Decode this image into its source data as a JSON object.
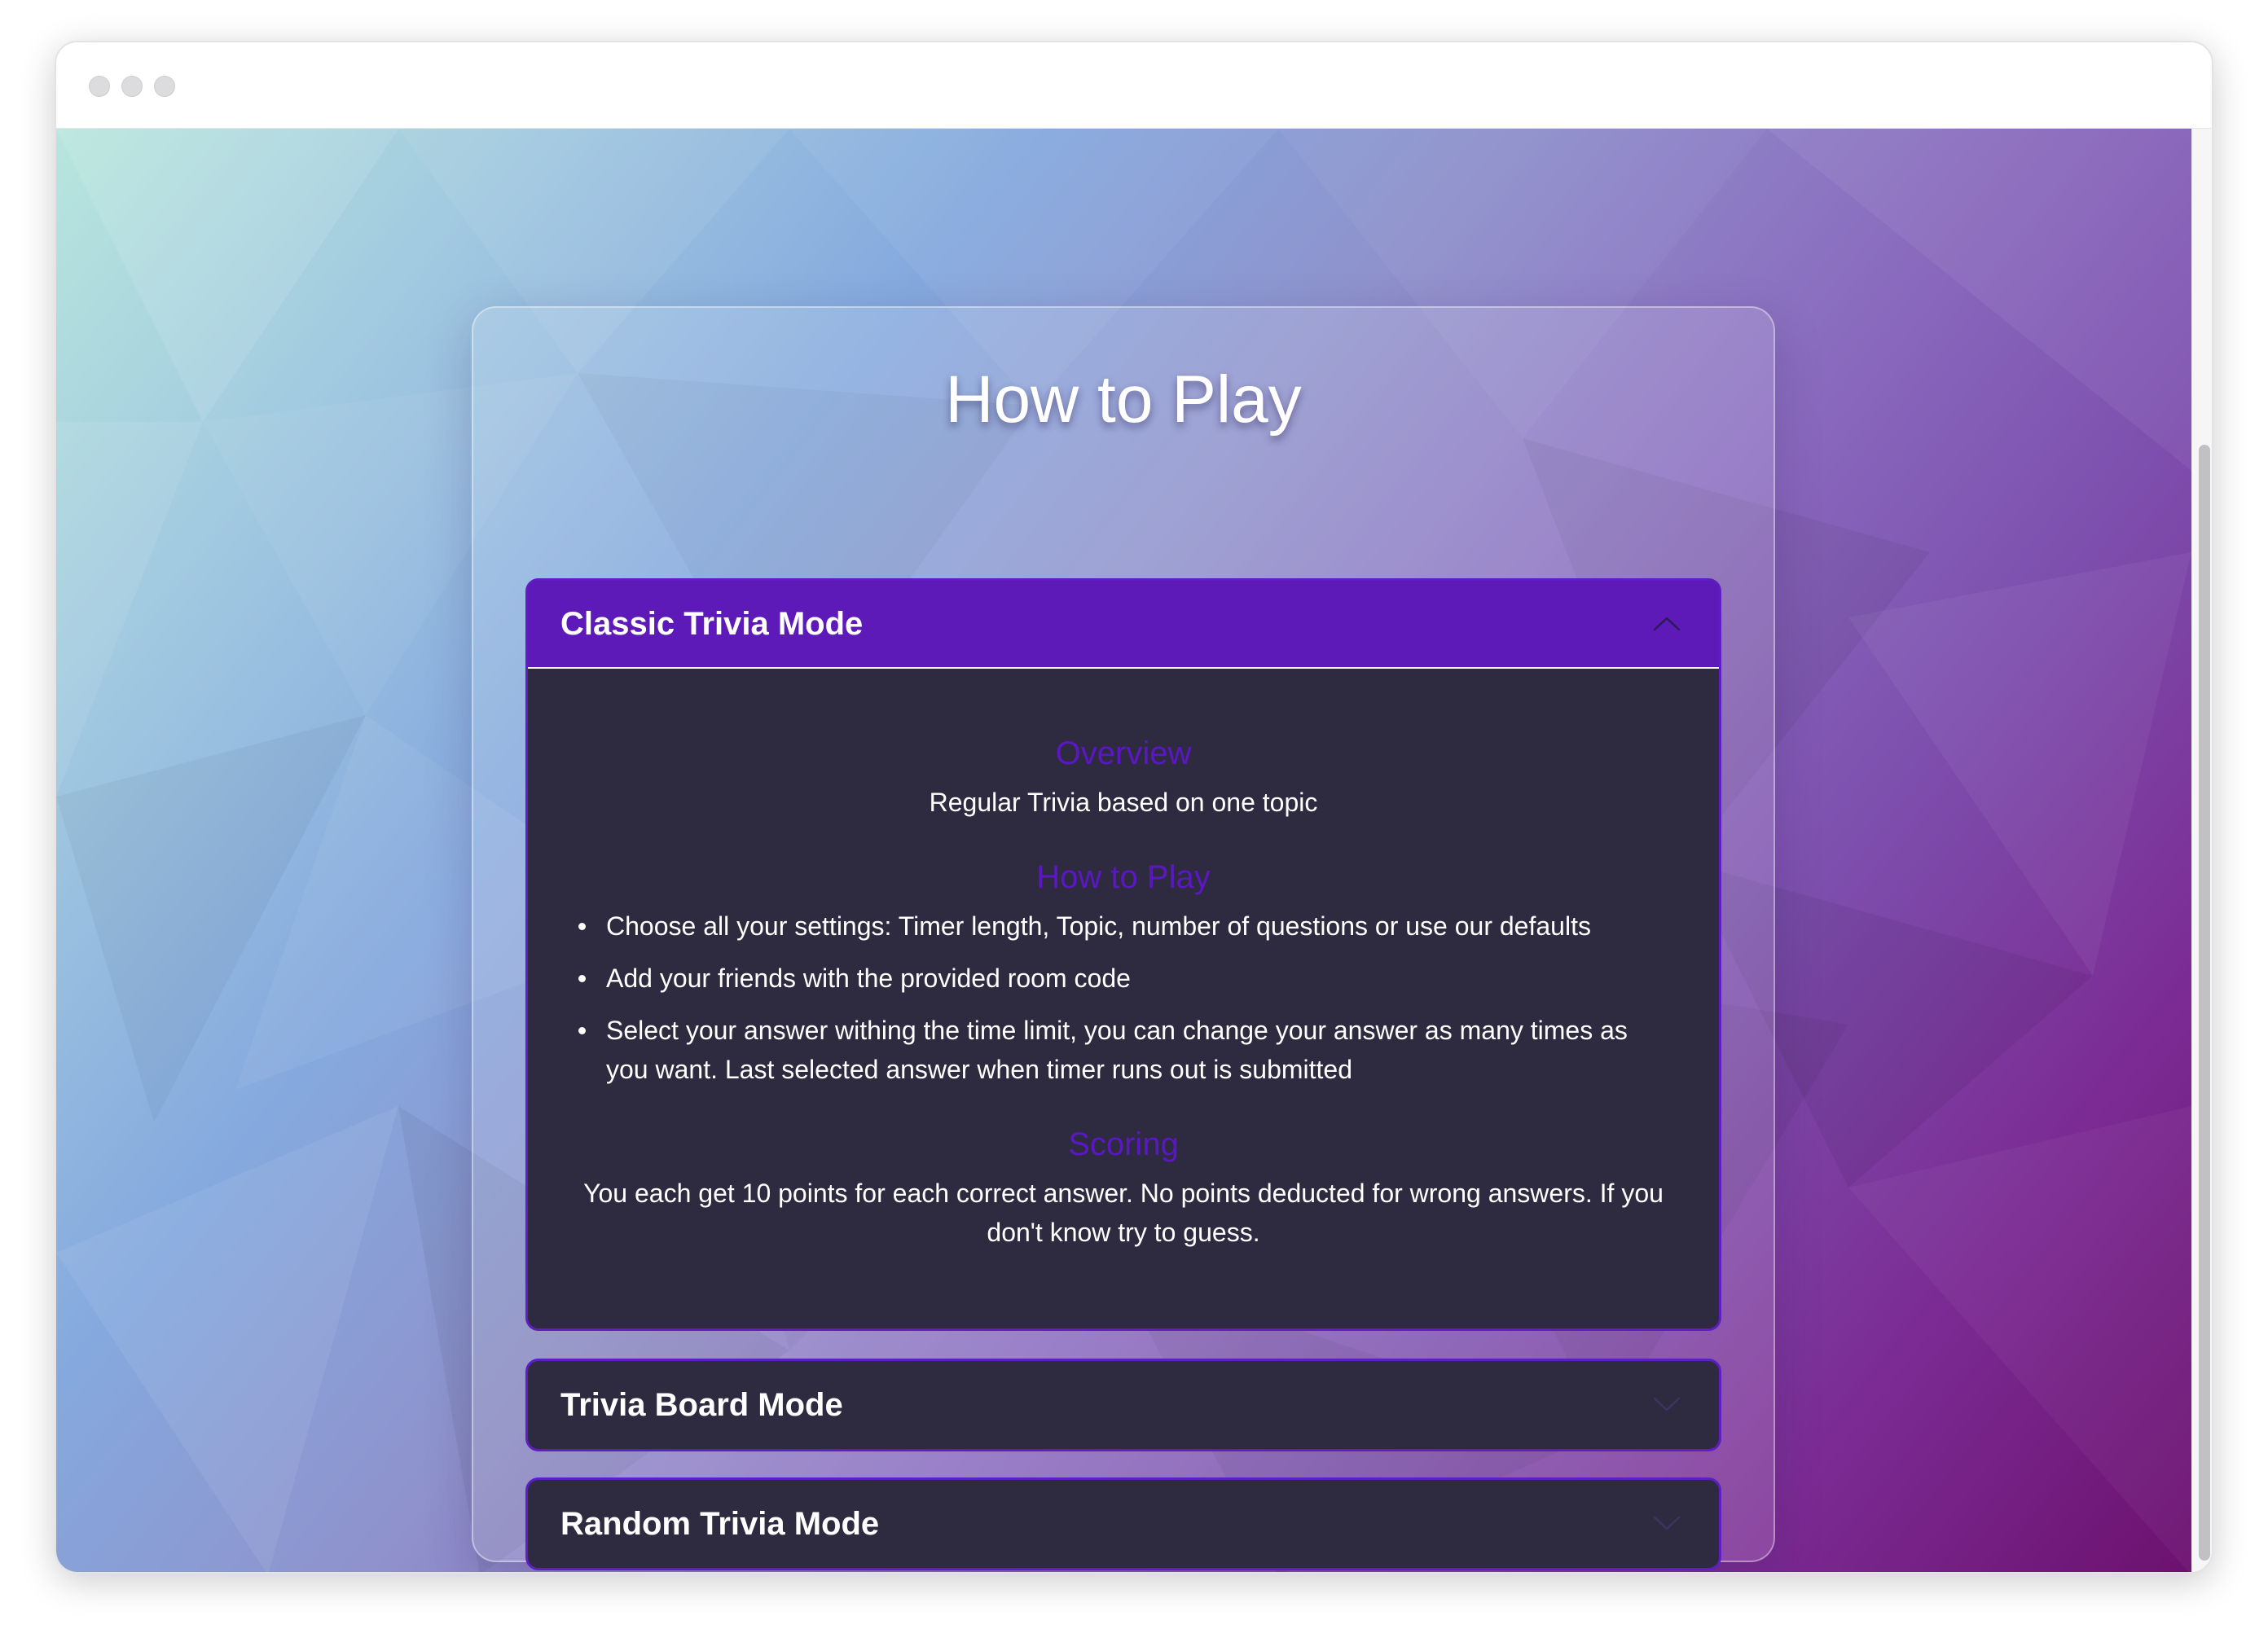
{
  "page": {
    "title": "How to Play"
  },
  "accordion": [
    {
      "label": "Classic Trivia Mode",
      "expanded": true,
      "sections": {
        "overview_title": "Overview",
        "overview_text": "Regular Trivia based on one topic",
        "howto_title": "How to Play",
        "howto_items": [
          "Choose all your settings: Timer length, Topic, number of questions or use our defaults",
          "Add your friends with the provided room code",
          "Select your answer withing the time limit, you can change your answer as many times as you want. Last selected answer when timer runs out is submitted"
        ],
        "scoring_title": "Scoring",
        "scoring_text": "You each get 10 points for each correct answer. No points deducted for wrong answers. If you don't know try to guess."
      }
    },
    {
      "label": "Trivia Board Mode",
      "expanded": false
    },
    {
      "label": "Random Trivia Mode",
      "expanded": false
    }
  ],
  "icons": {
    "expanded": "chevron-up-icon",
    "collapsed": "chevron-down-icon"
  },
  "colors": {
    "accent": "#5e1ab9",
    "section_title": "#5b17c4",
    "panel_bg": "#2e2a40"
  }
}
